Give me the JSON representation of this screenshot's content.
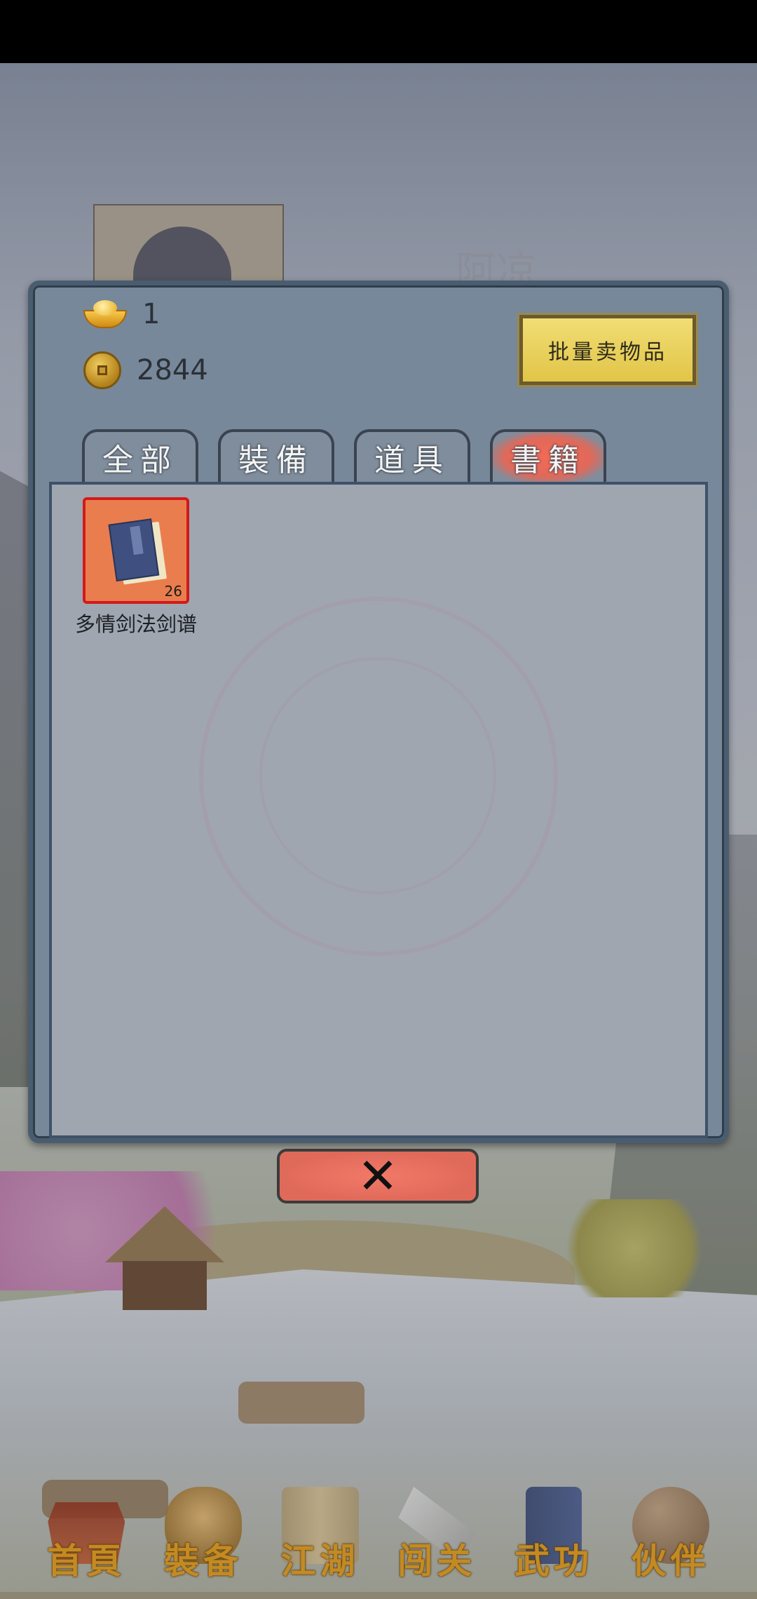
{
  "background": {
    "character_name": "阿凉"
  },
  "currency": {
    "ingot": "1",
    "coins": "2844"
  },
  "sell_button_label": "批量卖物品",
  "tabs": [
    {
      "label": "全部",
      "active": false
    },
    {
      "label": "裝備",
      "active": false
    },
    {
      "label": "道具",
      "active": false
    },
    {
      "label": "書籍",
      "active": true
    }
  ],
  "items": [
    {
      "name": "多情剑法剑谱",
      "count": "26",
      "icon": "book-icon"
    }
  ],
  "close_icon": "close-icon",
  "bottom_nav": [
    {
      "label": "首頁",
      "icon": "home-icon"
    },
    {
      "label": "裝备",
      "icon": "armor-icon"
    },
    {
      "label": "江湖",
      "icon": "scroll-map-icon"
    },
    {
      "label": "闯关",
      "icon": "crossed-swords-icon"
    },
    {
      "label": "武功",
      "icon": "martial-book-icon"
    },
    {
      "label": "伙伴",
      "icon": "partner-icon"
    }
  ],
  "colors": {
    "active_tab": "#e0695a",
    "sell_button": "#e1c548",
    "item_border": "#d21a1a",
    "nav_label": "#c48a22"
  }
}
